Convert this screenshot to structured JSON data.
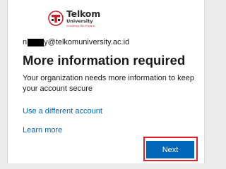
{
  "brand": {
    "name": "Telkom",
    "subname": "University",
    "tagline": "Creating the Future",
    "accent_color": "#cc1c24",
    "icon": "telkom-university-logo-icon"
  },
  "account": {
    "prefix": "n",
    "suffix": "y@telkomuniversity.ac.id"
  },
  "heading": "More information required",
  "description": "Your organization needs more information to keep your account secure",
  "links": {
    "different_account": "Use a different account",
    "learn_more": "Learn more"
  },
  "next_button": {
    "label": "Next",
    "color": "#0067b8",
    "highlight_color": "#e41e2b"
  }
}
